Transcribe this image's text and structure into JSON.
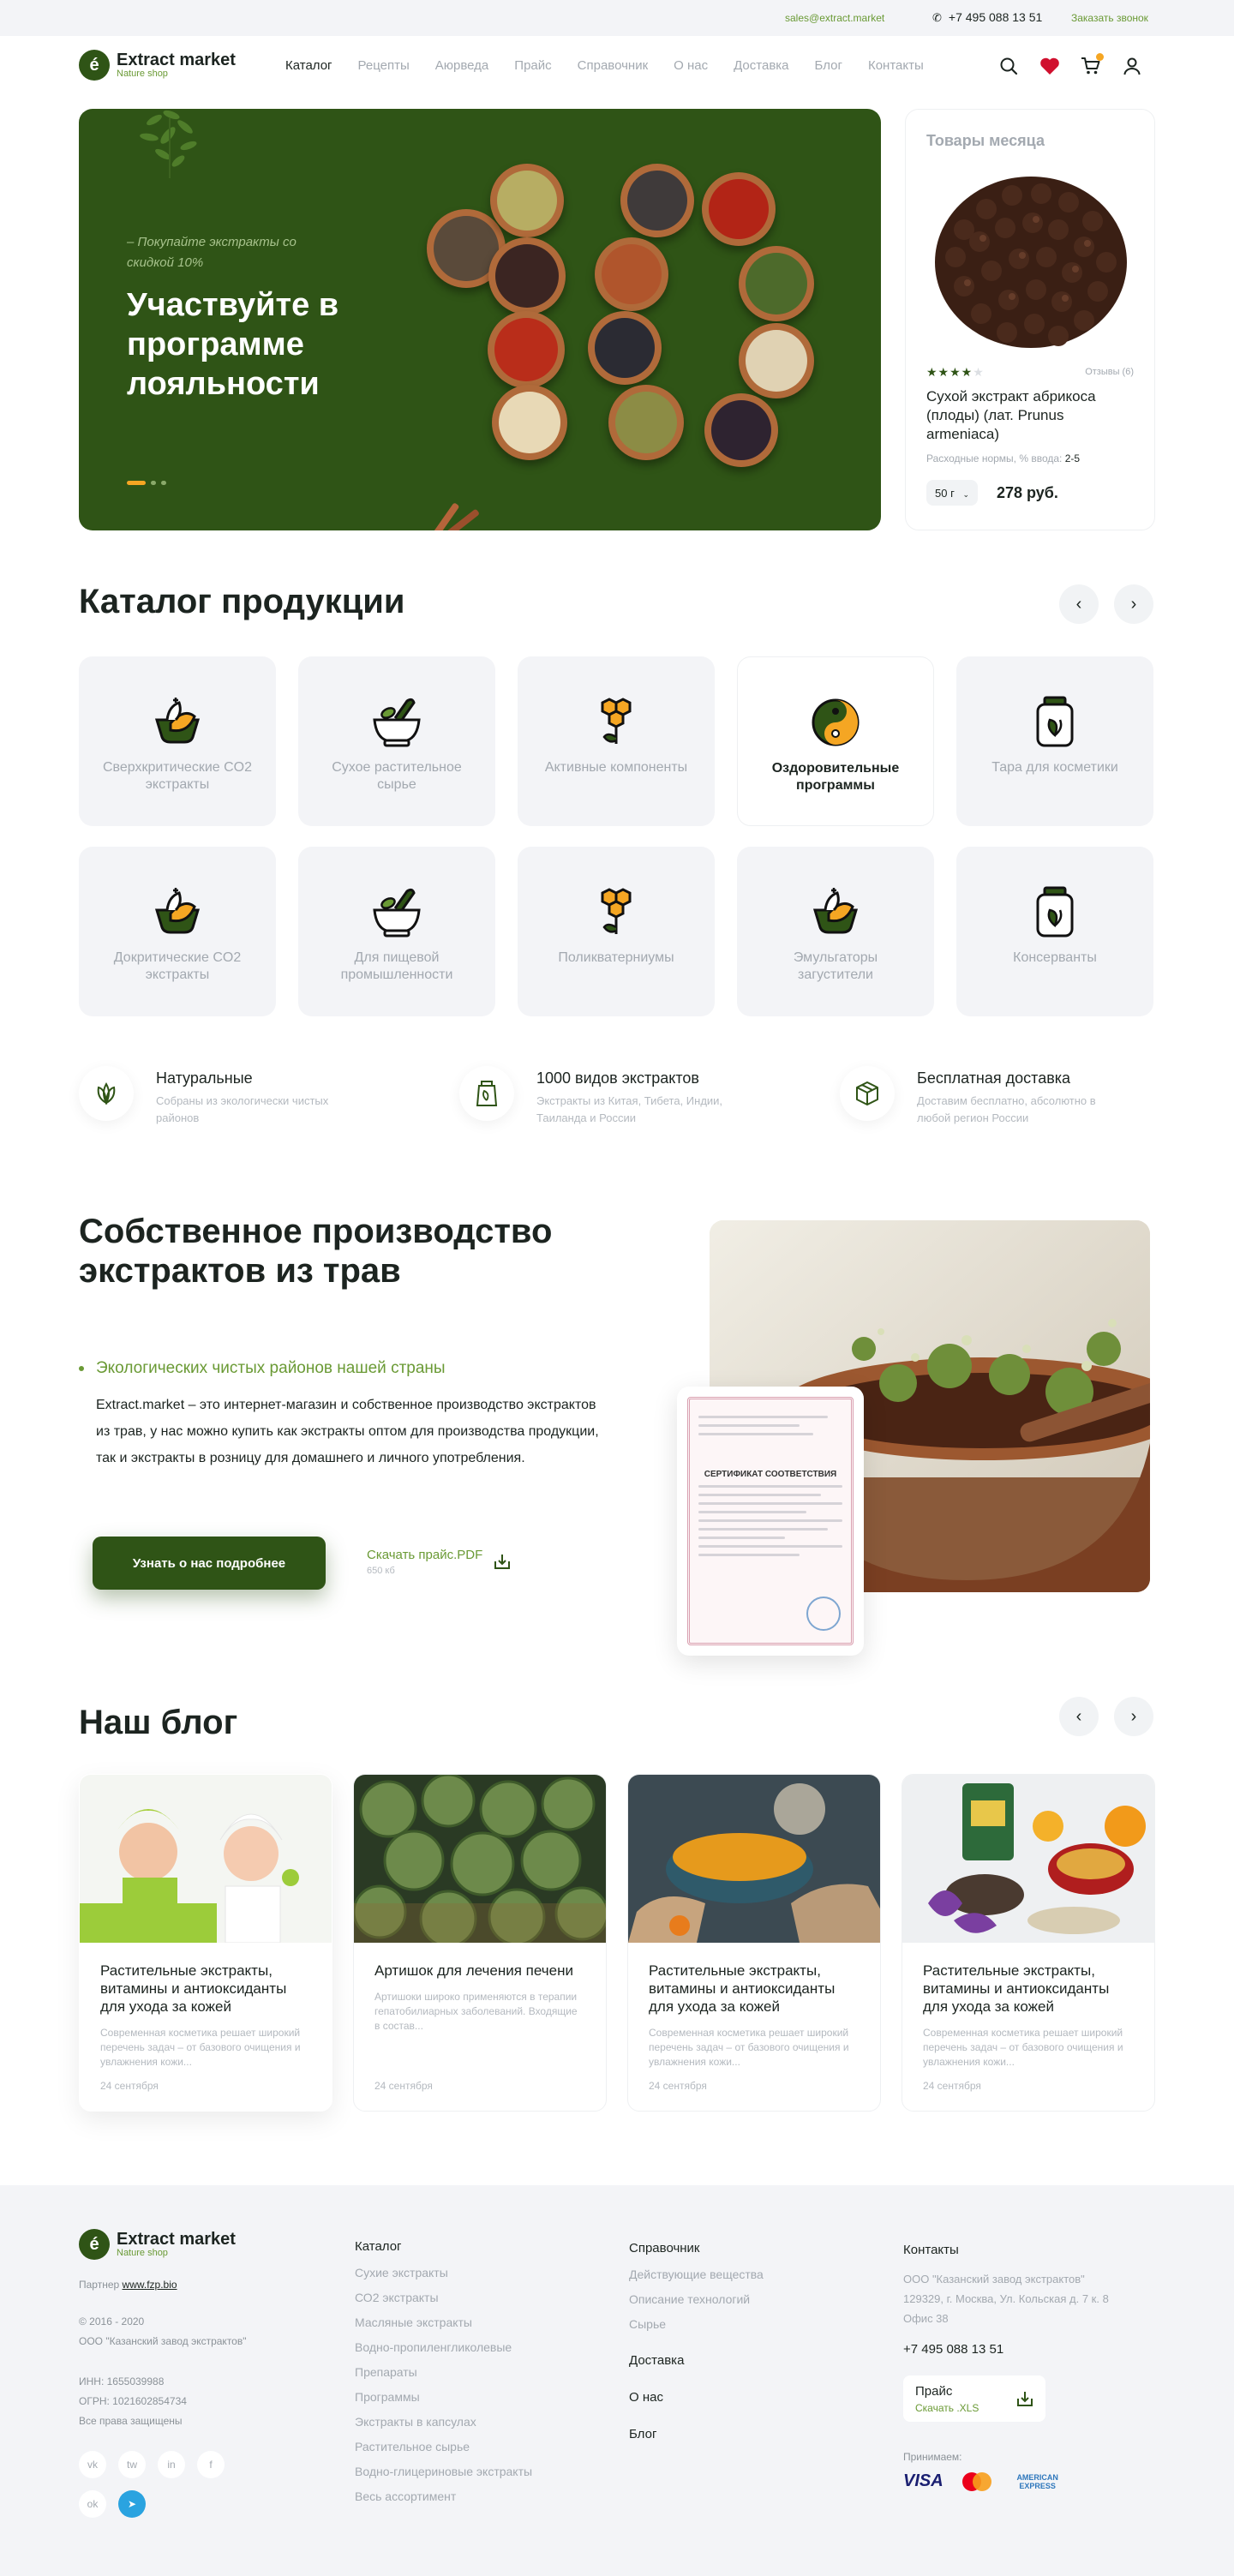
{
  "topbar": {
    "email": "sales@extract.market",
    "phone": "+7 495 088 13 51",
    "callback": "Заказать звонок"
  },
  "brand": {
    "name": "Extract market",
    "tagline": "Nature shop",
    "mark": "é"
  },
  "nav": [
    {
      "label": "Каталог",
      "active": true
    },
    {
      "label": "Рецепты"
    },
    {
      "label": "Аюрведа"
    },
    {
      "label": "Прайс"
    },
    {
      "label": "Справочник"
    },
    {
      "label": "О нас"
    },
    {
      "label": "Доставка"
    },
    {
      "label": "Блог"
    },
    {
      "label": "Контакты"
    }
  ],
  "header_icons": [
    "search-icon",
    "heart-icon",
    "cart-icon",
    "user-icon"
  ],
  "hero": {
    "subtitle": "– Покупайте экстракты со скидкой 10%",
    "title": "Участвуйте в программе лояльности"
  },
  "product_of_month": {
    "heading": "Товары месяца",
    "rating": 4,
    "rating_max": 5,
    "reviews": "Отзывы (6)",
    "name": "Сухой экстракт абрикоса (плоды) (лат. Prunus armeniaca)",
    "norm_label": "Расходные нормы, % вводa:",
    "norm_value": "2-5",
    "weight": "50 г",
    "price": "278 руб."
  },
  "catalog": {
    "title": "Каталог продукции",
    "items": [
      {
        "label": "Сверхкритические CO2 экстракты",
        "icon": "leaf-bowl-icon"
      },
      {
        "label": "Сухое растительное сырье",
        "icon": "mortar-icon"
      },
      {
        "label": "Активные компоненты",
        "icon": "honeycomb-icon"
      },
      {
        "label": "Оздоровительные программы",
        "icon": "yin-yang-icon",
        "active": true
      },
      {
        "label": "Тара для косметики",
        "icon": "jar-icon"
      },
      {
        "label": "Докритические CO2 экстракты",
        "icon": "leaf-bowl-icon"
      },
      {
        "label": "Для пищевой промышленности",
        "icon": "mortar-icon"
      },
      {
        "label": "Поликватерниумы",
        "icon": "honeycomb-icon"
      },
      {
        "label": "Эмульгаторы загустители",
        "icon": "leaf-bowl-icon"
      },
      {
        "label": "Консерванты",
        "icon": "jar-icon"
      }
    ]
  },
  "features": [
    {
      "title": "Натуральные",
      "text": "Собраны из экологически чистых районов",
      "icon": "leaf-icon"
    },
    {
      "title": "1000 видов экстрактов",
      "text": "Экстракты из Китая, Тибета, Индии, Таиланда и России",
      "icon": "jar-icon"
    },
    {
      "title": "Бесплатная доставка",
      "text": "Доставим бесплатно, абсолютно в любой регион России",
      "icon": "box-icon"
    }
  ],
  "production": {
    "title": "Собственное производство экстрактов из трав",
    "bullet": "Экологических чистых районов нашей страны",
    "text": "Extract.market – это интернет-магазин и собственное производство экстрактов из трав, у нас можно купить как экстракты оптом для производства продукции, так и экстракты в розницу для домашнего и личного употребления.",
    "button": "Узнать о нас подробнее",
    "pdf_label": "Скачать прайс.PDF",
    "pdf_size": "650 кб",
    "certificate_title": "СЕРТИФИКАТ СООТВЕТСТВИЯ"
  },
  "blog": {
    "title": "Наш блог",
    "posts": [
      {
        "title": "Растительные экстракты, витамины и антиоксиданты для ухода за кожей",
        "text": "Современная косметика решает широкий перечень задач – от базового очищения и увлажнения кожи...",
        "date": "24 сентября"
      },
      {
        "title": "Артишок для лечения печени",
        "text": "Артишоки широко применяются в терапии гепатобилиарных заболеваний. Входящие в состав...",
        "date": "24 сентября"
      },
      {
        "title": "Растительные экстракты, витамины и антиоксиданты для ухода за кожей",
        "text": "Современная косметика решает широкий перечень задач – от базового очищения и увлажнения кожи...",
        "date": "24 сентября"
      },
      {
        "title": "Растительные экстракты, витамины и антиоксиданты для ухода за кожей",
        "text": "Современная косметика решает широкий перечень задач – от базового очищения и увлажнения кожи...",
        "date": "24 сентября"
      }
    ]
  },
  "footer": {
    "partner_label": "Партнер",
    "partner_link": "www.fzp.bio",
    "years": "© 2016 - 2020",
    "company": "ООО \"Казанский завод экстрактов\"",
    "inn": "ИНН: 1655039988",
    "ogrn": "ОГРН: 1021602854734",
    "rights": "Все права защищены",
    "catalog_title": "Каталог",
    "catalog_links": [
      "Сухие экстракты",
      "СО2 экстракты",
      "Масляные экстракты",
      "Водно-пропиленгликолевые",
      "Препараты",
      "Программы",
      "Экстракты в капсулах",
      "Растительное сырье",
      "Водно-глицериновые экстракты",
      "Весь ассортимент"
    ],
    "ref_title": "Справочник",
    "ref_links": [
      "Действующие вещества",
      "Описание технологий",
      "Сырье"
    ],
    "delivery": "Доставка",
    "about": "О нас",
    "blog": "Блог",
    "contacts_title": "Контакты",
    "address": "ООО \"Казанский завод экстрактов\" 129329, г. Москва, Ул. Кольская д. 7 к. 8 Офис 38",
    "phone": "+7 495 088 13 51",
    "price_label": "Прайс",
    "price_link": "Скачать .XLS",
    "payment_label": "Принимаем:",
    "social": [
      {
        "name": "vk-icon",
        "glyph": "vk"
      },
      {
        "name": "twitter-icon",
        "glyph": "tw"
      },
      {
        "name": "instagram-icon",
        "glyph": "in"
      },
      {
        "name": "facebook-icon",
        "glyph": "f"
      },
      {
        "name": "odnoklassniki-icon",
        "glyph": "ok"
      },
      {
        "name": "telegram-icon",
        "glyph": "➤"
      }
    ],
    "payments": [
      "VISA",
      "AMERICAN EXPRESS"
    ]
  },
  "colors": {
    "primary": "#2f5416",
    "accent": "#6a9a35",
    "orange": "#f5a623",
    "heart": "#d0102e"
  }
}
